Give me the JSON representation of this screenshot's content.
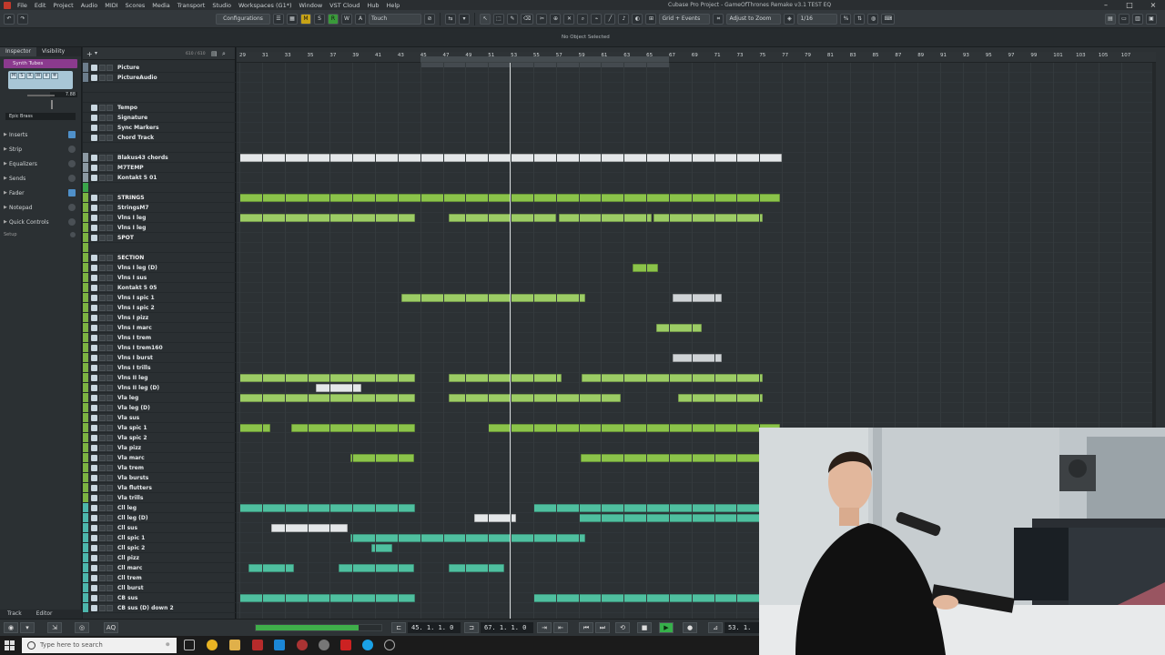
{
  "window": {
    "title": "Cubase Pro Project - GameOfThrones Remake v3.1 TEST EQ",
    "menu": [
      "File",
      "Edit",
      "Project",
      "Audio",
      "MIDI",
      "Scores",
      "Media",
      "Transport",
      "Studio",
      "Workspaces (G1*)",
      "Window",
      "VST Cloud",
      "Hub",
      "Help"
    ]
  },
  "toolbar": {
    "configurations": "Configurations",
    "m_label": "M",
    "s_label": "S",
    "r_label": "R",
    "w_label": "W",
    "a_label": "A",
    "automation_mode": "Touch",
    "snap_type": "Grid + Events",
    "zoom_mode": "Adjust to Zoom",
    "quantize": "1/16"
  },
  "status": {
    "selection": "No Object Selected"
  },
  "inspector": {
    "tabs": [
      "Inspector",
      "Visibility"
    ],
    "track_name": "Synth Tubes",
    "preset": "Epic Brass",
    "volume": "7.88",
    "sections": [
      "Inserts",
      "Strip",
      "Equalizers",
      "Sends",
      "Fader",
      "Notepad",
      "Quick Controls"
    ],
    "setup": "Setup",
    "bottom_tabs": [
      "Track",
      "Editor"
    ]
  },
  "tracklist": {
    "count": "610 / 610",
    "tracks": [
      {
        "name": "Picture",
        "color": "#6c7d8c",
        "kind": "video"
      },
      {
        "name": "PictureAudio",
        "color": "#6c7d8c",
        "kind": "audio"
      },
      {
        "name": "",
        "color": "#2a2f32",
        "kind": "empty"
      },
      {
        "name": "",
        "color": "#2a2f32",
        "kind": "empty"
      },
      {
        "name": "Tempo",
        "color": "#2a2f32",
        "kind": "tempo"
      },
      {
        "name": "Signature",
        "color": "#2a2f32",
        "kind": "signature"
      },
      {
        "name": "Sync Markers",
        "color": "#2a2f32",
        "kind": "marker"
      },
      {
        "name": "Chord Track",
        "color": "#2a2f32",
        "kind": "chord"
      },
      {
        "name": "",
        "color": "#2a2f32",
        "kind": "empty"
      },
      {
        "name": "Blakus43 chords",
        "color": "#8c99a3",
        "kind": "instrument"
      },
      {
        "name": "M7TEMP",
        "color": "#8c99a3",
        "kind": "instrument"
      },
      {
        "name": "Kontakt 5 01",
        "color": "#8c99a3",
        "kind": "instrument"
      },
      {
        "name": "",
        "color": "#3aa54a",
        "kind": "empty"
      },
      {
        "name": "STRINGS",
        "color": "#7cb342",
        "kind": "folder"
      },
      {
        "name": "StringsM7",
        "color": "#7cb342",
        "kind": "instrument"
      },
      {
        "name": "Vlns I leg",
        "color": "#7cb342",
        "kind": "instrument"
      },
      {
        "name": "Vlns I leg",
        "color": "#7cb342",
        "kind": "instrument"
      },
      {
        "name": "SPOT",
        "color": "#7cb342",
        "kind": "folder"
      },
      {
        "name": "",
        "color": "#7cb342",
        "kind": "empty"
      },
      {
        "name": "SECTION",
        "color": "#7cb342",
        "kind": "folder"
      },
      {
        "name": "Vlns I leg (D)",
        "color": "#7cb342",
        "kind": "instrument"
      },
      {
        "name": "Vlns I sus",
        "color": "#7cb342",
        "kind": "instrument"
      },
      {
        "name": "Kontakt 5 05",
        "color": "#7cb342",
        "kind": "instrument"
      },
      {
        "name": "Vlns I spic 1",
        "color": "#7cb342",
        "kind": "instrument"
      },
      {
        "name": "Vlns I spic 2",
        "color": "#7cb342",
        "kind": "instrument"
      },
      {
        "name": "Vlns I pizz",
        "color": "#7cb342",
        "kind": "instrument"
      },
      {
        "name": "Vlns I marc",
        "color": "#7cb342",
        "kind": "instrument"
      },
      {
        "name": "Vlns I trem",
        "color": "#7cb342",
        "kind": "instrument"
      },
      {
        "name": "Vlns I trem160",
        "color": "#7cb342",
        "kind": "instrument"
      },
      {
        "name": "Vlns I burst",
        "color": "#7cb342",
        "kind": "instrument"
      },
      {
        "name": "Vlns I trills",
        "color": "#7cb342",
        "kind": "instrument"
      },
      {
        "name": "Vlns II leg",
        "color": "#7cb342",
        "kind": "instrument"
      },
      {
        "name": "Vlns II leg (D)",
        "color": "#7cb342",
        "kind": "instrument"
      },
      {
        "name": "Vla leg",
        "color": "#7cb342",
        "kind": "instrument"
      },
      {
        "name": "Vla leg (D)",
        "color": "#7cb342",
        "kind": "instrument"
      },
      {
        "name": "Vla sus",
        "color": "#7cb342",
        "kind": "instrument"
      },
      {
        "name": "Vla spic 1",
        "color": "#7cb342",
        "kind": "instrument"
      },
      {
        "name": "Vla spic 2",
        "color": "#7cb342",
        "kind": "instrument"
      },
      {
        "name": "Vla pizz",
        "color": "#7cb342",
        "kind": "instrument"
      },
      {
        "name": "Vla marc",
        "color": "#7cb342",
        "kind": "instrument"
      },
      {
        "name": "Vla trem",
        "color": "#7cb342",
        "kind": "instrument"
      },
      {
        "name": "Vla bursts",
        "color": "#7cb342",
        "kind": "instrument"
      },
      {
        "name": "Vla flutters",
        "color": "#7cb342",
        "kind": "instrument"
      },
      {
        "name": "Vla trills",
        "color": "#7cb342",
        "kind": "instrument"
      },
      {
        "name": "Cll leg",
        "color": "#4db6ac",
        "kind": "instrument"
      },
      {
        "name": "Cll leg (D)",
        "color": "#4db6ac",
        "kind": "instrument"
      },
      {
        "name": "Cll sus",
        "color": "#4db6ac",
        "kind": "instrument"
      },
      {
        "name": "Cll spic 1",
        "color": "#4db6ac",
        "kind": "instrument"
      },
      {
        "name": "Cll spic 2",
        "color": "#4db6ac",
        "kind": "instrument"
      },
      {
        "name": "Cll pizz",
        "color": "#4db6ac",
        "kind": "instrument"
      },
      {
        "name": "Cll marc",
        "color": "#4db6ac",
        "kind": "instrument"
      },
      {
        "name": "Cll trem",
        "color": "#4db6ac",
        "kind": "instrument"
      },
      {
        "name": "Cll burst",
        "color": "#4db6ac",
        "kind": "instrument"
      },
      {
        "name": "CB sus",
        "color": "#4db6ac",
        "kind": "instrument"
      },
      {
        "name": "CB sus (D) down 2",
        "color": "#4db6ac",
        "kind": "instrument"
      }
    ]
  },
  "ruler": {
    "bars": [
      "29",
      "31",
      "33",
      "35",
      "37",
      "39",
      "41",
      "43",
      "45",
      "47",
      "49",
      "51",
      "53",
      "55",
      "57",
      "59",
      "61",
      "63",
      "65",
      "67",
      "69",
      "71",
      "73",
      "75",
      "77",
      "79",
      "81",
      "83",
      "85",
      "87",
      "89",
      "91",
      "93",
      "95",
      "97",
      "99",
      "101",
      "103",
      "105",
      "107"
    ]
  },
  "arrangement": {
    "parts": [
      {
        "lane": 9,
        "start": 29,
        "end": 77.0,
        "style": "white"
      },
      {
        "lane": 13,
        "start": 29,
        "end": 76.8,
        "style": "green"
      },
      {
        "lane": 15,
        "start": 29,
        "end": 44.5,
        "style": "lightgreen"
      },
      {
        "lane": 15,
        "start": 47.5,
        "end": 57.0,
        "style": "lightgreen"
      },
      {
        "lane": 15,
        "start": 57.3,
        "end": 65.5,
        "style": "lightgreen"
      },
      {
        "lane": 15,
        "start": 65.6,
        "end": 75.3,
        "style": "lightgreen"
      },
      {
        "lane": 20,
        "start": 63.8,
        "end": 66.0,
        "style": "green"
      },
      {
        "lane": 23,
        "start": 43.3,
        "end": 59.6,
        "style": "lightgreen"
      },
      {
        "lane": 23,
        "start": 67.3,
        "end": 71.7,
        "style": "gray"
      },
      {
        "lane": 26,
        "start": 65.9,
        "end": 69.9,
        "style": "lightgreen"
      },
      {
        "lane": 29,
        "start": 67.3,
        "end": 71.7,
        "style": "gray"
      },
      {
        "lane": 31,
        "start": 29,
        "end": 44.5,
        "style": "lightgreen"
      },
      {
        "lane": 31,
        "start": 47.5,
        "end": 57.5,
        "style": "lightgreen"
      },
      {
        "lane": 31,
        "start": 59.3,
        "end": 75.3,
        "style": "lightgreen"
      },
      {
        "lane": 32,
        "start": 35.8,
        "end": 39.8,
        "style": "white"
      },
      {
        "lane": 33,
        "start": 29,
        "end": 44.5,
        "style": "lightgreen"
      },
      {
        "lane": 33,
        "start": 47.5,
        "end": 62.7,
        "style": "lightgreen"
      },
      {
        "lane": 33,
        "start": 67.8,
        "end": 75.3,
        "style": "lightgreen"
      },
      {
        "lane": 36,
        "start": 29,
        "end": 31.7,
        "style": "green"
      },
      {
        "lane": 36,
        "start": 33.6,
        "end": 44.5,
        "style": "green"
      },
      {
        "lane": 36,
        "start": 51.0,
        "end": 76.8,
        "style": "green"
      },
      {
        "lane": 39,
        "start": 38.8,
        "end": 44.5,
        "style": "green"
      },
      {
        "lane": 39,
        "start": 59.2,
        "end": 77.5,
        "style": "green"
      },
      {
        "lane": 44,
        "start": 29,
        "end": 44.5,
        "style": "teal"
      },
      {
        "lane": 44,
        "start": 55.0,
        "end": 77.5,
        "style": "teal"
      },
      {
        "lane": 45,
        "start": 49.8,
        "end": 53.5,
        "style": "white"
      },
      {
        "lane": 45,
        "start": 59.0,
        "end": 77.5,
        "style": "teal"
      },
      {
        "lane": 46,
        "start": 31.8,
        "end": 38.6,
        "style": "white"
      },
      {
        "lane": 47,
        "start": 38.8,
        "end": 59.6,
        "style": "teal"
      },
      {
        "lane": 48,
        "start": 40.7,
        "end": 42.5,
        "style": "teal"
      },
      {
        "lane": 50,
        "start": 29.8,
        "end": 33.8,
        "style": "teal"
      },
      {
        "lane": 50,
        "start": 37.8,
        "end": 44.5,
        "style": "teal"
      },
      {
        "lane": 50,
        "start": 47.5,
        "end": 52.4,
        "style": "teal"
      },
      {
        "lane": 53,
        "start": 29,
        "end": 44.5,
        "style": "teal"
      },
      {
        "lane": 53,
        "start": 55.0,
        "end": 77.5,
        "style": "teal"
      }
    ],
    "playhead_bar": 52.9
  },
  "transport": {
    "left_locator": "45. 1. 1.   0",
    "right_locator": "67. 1. 1.   0",
    "position": "53. 1. 1",
    "progress": 0.82
  },
  "taskbar": {
    "search_placeholder": "Type here to search"
  },
  "colors": {
    "accent_green": "#8bc34a",
    "accent_teal": "#4fbf9f",
    "play_green": "#36b04a",
    "record_red": "#c0392b"
  }
}
